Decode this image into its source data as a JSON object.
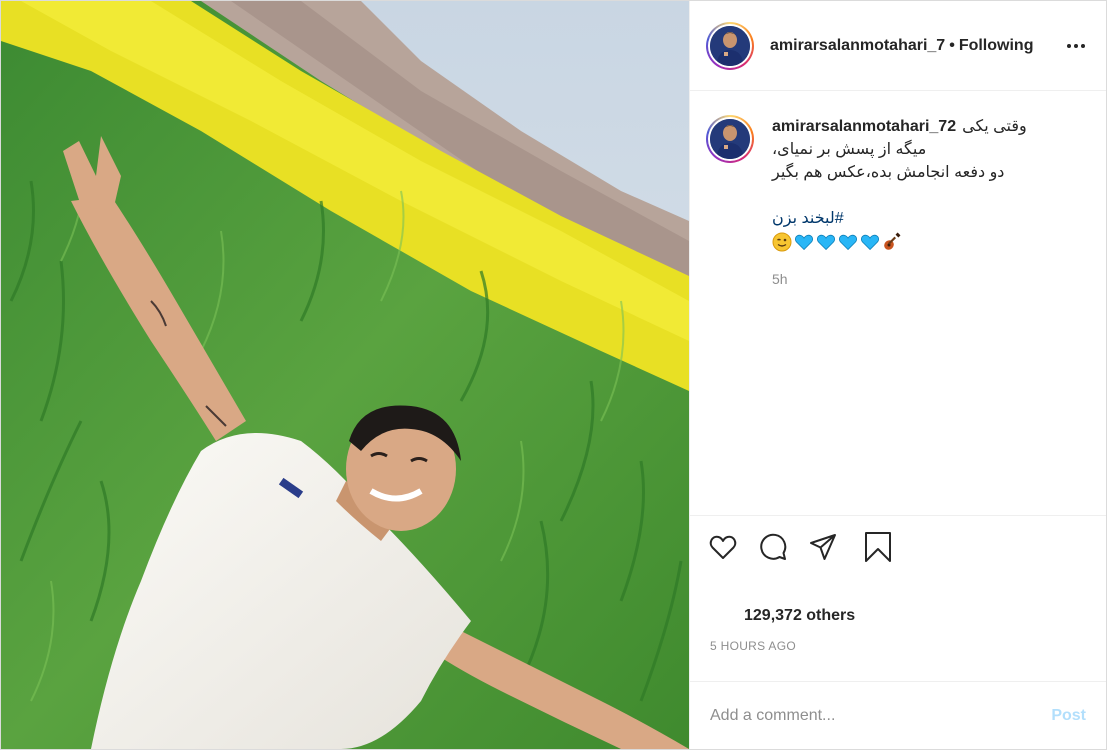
{
  "post": {
    "username": "amirarsalanmotahari_7",
    "separator": "•",
    "follow_status": "Following",
    "more_icon": "more-options-icon",
    "image_icon": "post-photo"
  },
  "caption": {
    "username": "amirarsalanmotahari_72",
    "first_line_text": "وقتی یکی",
    "lines": [
      "میگه از پسش بر نمیای،",
      "دو دفعه انجامش بده،عکس هم بگیر"
    ],
    "hashtag": "#لبخند بزن",
    "emojis": [
      "guitar-emoji",
      "blue-heart-emoji",
      "blue-heart-emoji",
      "blue-heart-emoji",
      "blue-heart-emoji",
      "wink-emoji"
    ],
    "age": "5h"
  },
  "actions": {
    "like_icon": "heart-icon",
    "comment_icon": "comment-icon",
    "share_icon": "share-icon",
    "save_icon": "bookmark-icon"
  },
  "likes": {
    "text": "129,372 others"
  },
  "timestamp": "5 HOURS AGO",
  "comment_form": {
    "placeholder": "Add a comment...",
    "post_label": "Post"
  },
  "colors": {
    "text": "#262626",
    "secondary": "#8e8e8e",
    "link": "#00376b",
    "post_disabled": "#b2dffc",
    "border": "#efefef"
  }
}
